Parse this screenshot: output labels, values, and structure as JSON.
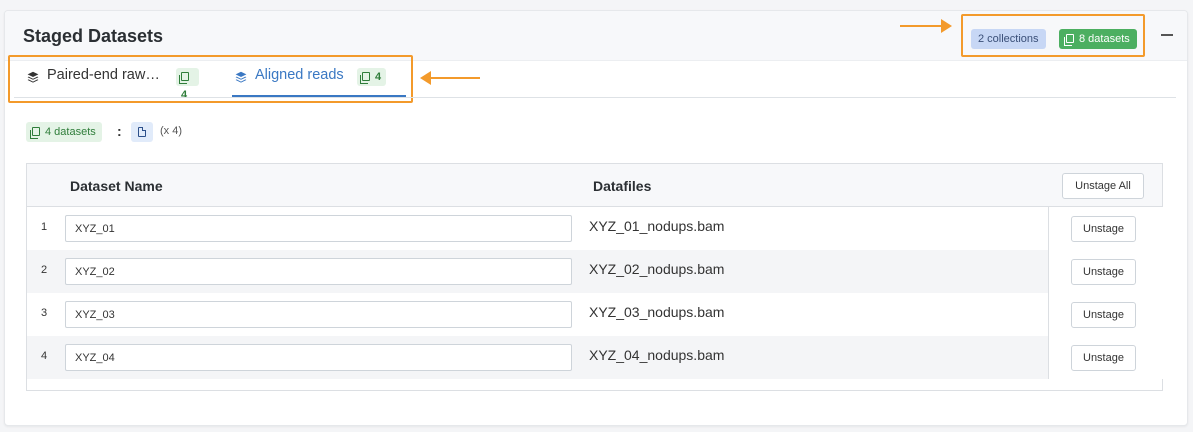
{
  "header": {
    "title": "Staged Datasets",
    "collections_badge": "2 collections",
    "datasets_badge": "8 datasets"
  },
  "tabs": [
    {
      "label": "Paired-end raw…",
      "count": "4",
      "active": false
    },
    {
      "label": "Aligned reads",
      "count": "4",
      "active": true
    }
  ],
  "summary": {
    "datasets_badge": "4 datasets",
    "separator": ":",
    "multiplier": "(x 4)"
  },
  "table": {
    "columns": [
      "Dataset Name",
      "Datafiles"
    ],
    "unstage_all_label": "Unstage All",
    "unstage_label": "Unstage",
    "rows": [
      {
        "num": "1",
        "name": "XYZ_01",
        "file": "XYZ_01_nodups.bam"
      },
      {
        "num": "2",
        "name": "XYZ_02",
        "file": "XYZ_02_nodups.bam"
      },
      {
        "num": "3",
        "name": "XYZ_03",
        "file": "XYZ_03_nodups.bam"
      },
      {
        "num": "4",
        "name": "XYZ_04",
        "file": "XYZ_04_nodups.bam"
      }
    ]
  },
  "colors": {
    "accent": "#3a78c3",
    "highlight": "#f39a2b",
    "success": "#4caf61",
    "collections": "#c7d7f5"
  },
  "icons": [
    "layers-icon",
    "copy-icon",
    "file-icon",
    "minus-icon",
    "arrow-icon"
  ]
}
